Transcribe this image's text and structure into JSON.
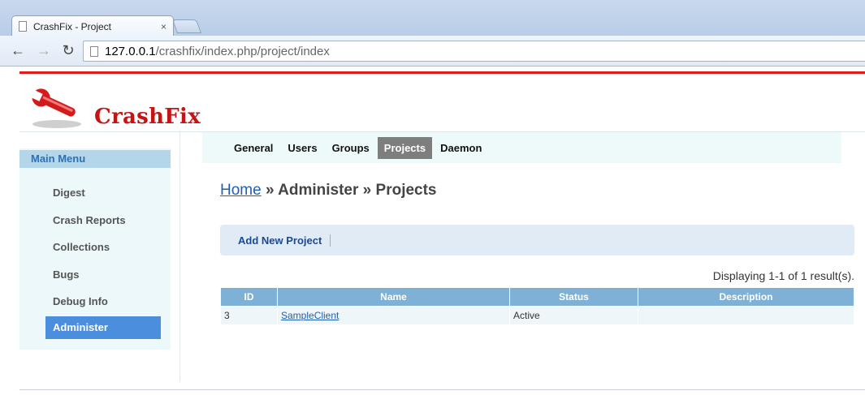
{
  "browser": {
    "tab_title": "CrashFix - Project",
    "tab_close": "×",
    "url_host": "127.0.0.1",
    "url_path": "/crashfix/index.php/project/index"
  },
  "app": {
    "logo_text": "CrashFix",
    "brand_color": "#c41414"
  },
  "topmenu": {
    "items": [
      "General",
      "Users",
      "Groups",
      "Projects",
      "Daemon"
    ],
    "active": "Projects"
  },
  "sidebar": {
    "title": "Main Menu",
    "items": [
      "Digest",
      "Crash Reports",
      "Collections",
      "Bugs",
      "Debug Info",
      "Administer"
    ],
    "active": "Administer"
  },
  "breadcrumb": {
    "home": "Home",
    "sep": "»",
    "level1": "Administer",
    "level2": "Projects"
  },
  "actions": {
    "add_project": "Add New Project"
  },
  "grid": {
    "summary": "Displaying 1-1 of 1 result(s).",
    "columns": [
      "ID",
      "Name",
      "Status",
      "Description"
    ],
    "rows": [
      {
        "id": "3",
        "name": "SampleClient",
        "status": "Active",
        "description": ""
      }
    ]
  }
}
